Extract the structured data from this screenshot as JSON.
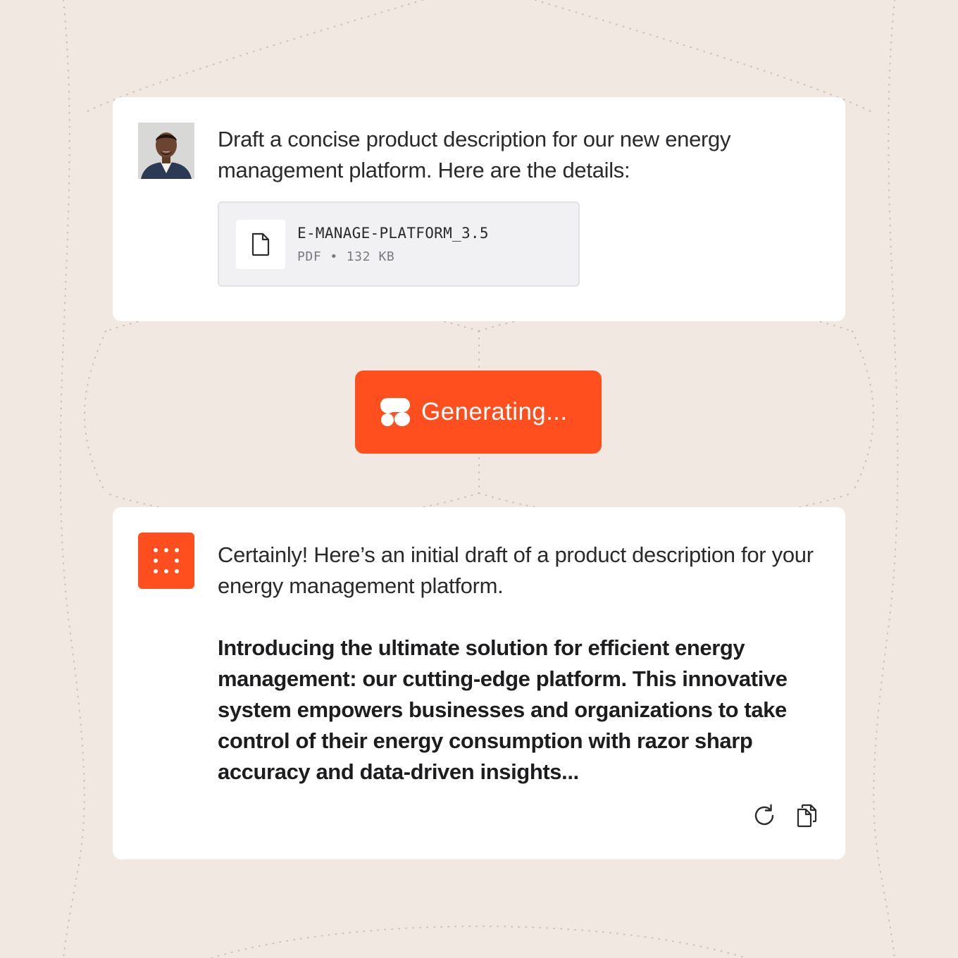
{
  "user_message": {
    "avatar_icon": "user-avatar",
    "text": "Draft a concise product description for our new energy management platform. Here are the details:",
    "attachment": {
      "icon": "document-icon",
      "file_name": "E-MANAGE-PLATFORM_3.5",
      "file_type": "PDF",
      "separator": "•",
      "file_size": "132 KB"
    }
  },
  "status": {
    "icon": "logo-icon",
    "label": "Generating..."
  },
  "ai_message": {
    "logo_icon": "dot-grid-logo-icon",
    "intro": "Certainly! Here’s an initial draft of a product description for your energy management platform.",
    "body": "Introducing the ultimate solution for efficient energy management: our cutting-edge platform. This innovative system empowers businesses and organizations to take control of their energy consumption with razor sharp accuracy and data-driven insights...",
    "actions": [
      {
        "name": "regenerate",
        "icon": "refresh-icon"
      },
      {
        "name": "copy",
        "icon": "copy-icon"
      }
    ]
  },
  "colors": {
    "background": "#f0e8e1",
    "card": "#ffffff",
    "accent": "#ff4f1f",
    "file_chip": "#f1f0f2",
    "muted_text": "#7a7980"
  }
}
